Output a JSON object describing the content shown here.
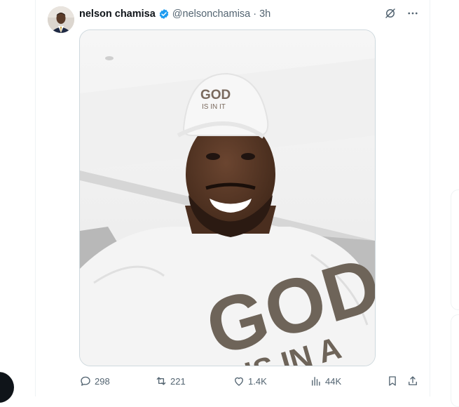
{
  "tweet": {
    "author": {
      "display_name": "nelson chamisa",
      "handle": "@nelsonchamisa",
      "separator": "·",
      "time": "3h"
    },
    "media": {
      "cap_line1": "GOD",
      "cap_line2": "IS IN IT",
      "shirt_line1": "GOD",
      "shirt_line2": "IS IN A"
    },
    "actions": {
      "replies": "298",
      "reposts": "221",
      "likes": "1.4K",
      "views": "44K"
    }
  },
  "colors": {
    "verified_badge": "#1d9bf0",
    "muted_text": "#536471",
    "primary_text": "#0f1419",
    "border": "#cfd9de"
  },
  "icons": [
    "verified-badge-icon",
    "grok-icon",
    "more-icon",
    "reply-icon",
    "repost-icon",
    "like-icon",
    "views-icon",
    "bookmark-icon",
    "share-icon"
  ]
}
